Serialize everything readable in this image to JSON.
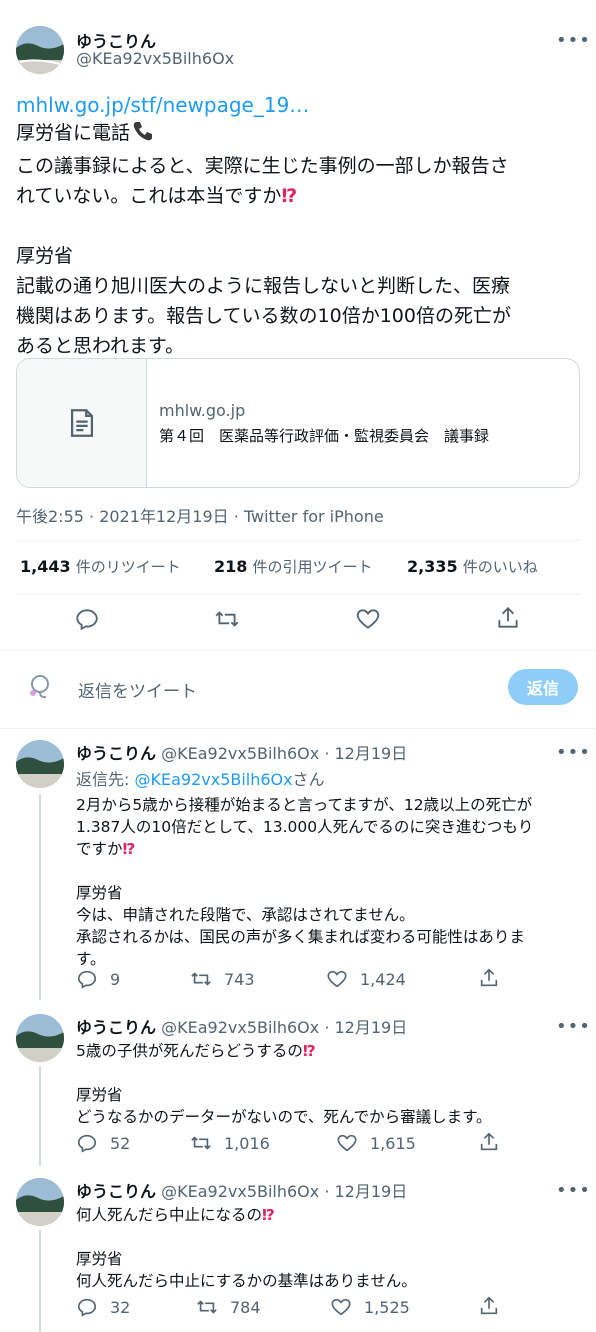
{
  "main_tweet": {
    "author_name": "ゆうこりん",
    "author_handle": "@KEa92vx5Bilh6Ox",
    "more_icon": "more-dots-icon",
    "link_text": "mhlw.go.jp/stf/newpage_19…",
    "line1": "厚労省に電話",
    "phone_icon": "phone-icon",
    "line2": "この議事録によると、実際に生じた事例の一部しか報告さ",
    "line3": "れていない。これは本当ですか",
    "interrobang": "⁉",
    "line4": "厚労省",
    "line5": "記載の通り旭川医大のように報告しないと判断した、医療",
    "line6": "機関はあります。報告している数の10倍か100倍の死亡が",
    "line7": "あると思われます。",
    "card_domain": "mhlw.go.jp",
    "card_title": "第４回　医薬品等行政評価・監視委員会　議事録",
    "timestamp": "午後2:55 · 2021年12月19日 · Twitter for iPhone",
    "retweets_count": "1,443",
    "retweets_label": "件のリツイート",
    "quotes_count": "218",
    "quotes_label": "件の引用ツイート",
    "likes_count": "2,335",
    "likes_label": "件のいいね"
  },
  "composer": {
    "placeholder": "返信をツイート",
    "reply_button": "返信"
  },
  "replies": [
    {
      "name": "ゆうこりん",
      "handle_date": "@KEa92vx5Bilh6Ox · 12月19日",
      "reply_to_prefix": "返信先: ",
      "reply_to_handle": "@KEa92vx5Bilh6Ox",
      "reply_to_suffix": "さん",
      "lines": [
        "2月から5歳から接種が始まると言ってますが、12歳以上の死亡が",
        "1.387人の10倍だとして、13.000人死んでるのに突き進むつもり",
        "ですか"
      ],
      "lines2": [
        "厚労省",
        "今は、申請された段階で、承認はされてません。",
        "承認されるかは、国民の声が多く集まれば変わる可能性はありま",
        "す。"
      ],
      "replies": "9",
      "retweets": "743",
      "likes": "1,424"
    },
    {
      "name": "ゆうこりん",
      "handle_date": "@KEa92vx5Bilh6Ox · 12月19日",
      "lines": [
        "5歳の子供が死んだらどうするの"
      ],
      "lines2": [
        "厚労省",
        "どうなるかのデーターがないので、死んでから審議します。"
      ],
      "replies": "52",
      "retweets": "1,016",
      "likes": "1,615"
    },
    {
      "name": "ゆうこりん",
      "handle_date": "@KEa92vx5Bilh6Ox · 12月19日",
      "lines": [
        "何人死んだら中止になるの"
      ],
      "lines2": [
        "厚労省",
        "何人死んだら中止にするかの基準はありません。"
      ],
      "replies": "32",
      "retweets": "784",
      "likes": "1,525"
    }
  ],
  "colors": {
    "accent": "#1d9bf0",
    "reply_button": "#8ecdf7",
    "muted": "#536471",
    "interrobang": "#e0245e"
  }
}
